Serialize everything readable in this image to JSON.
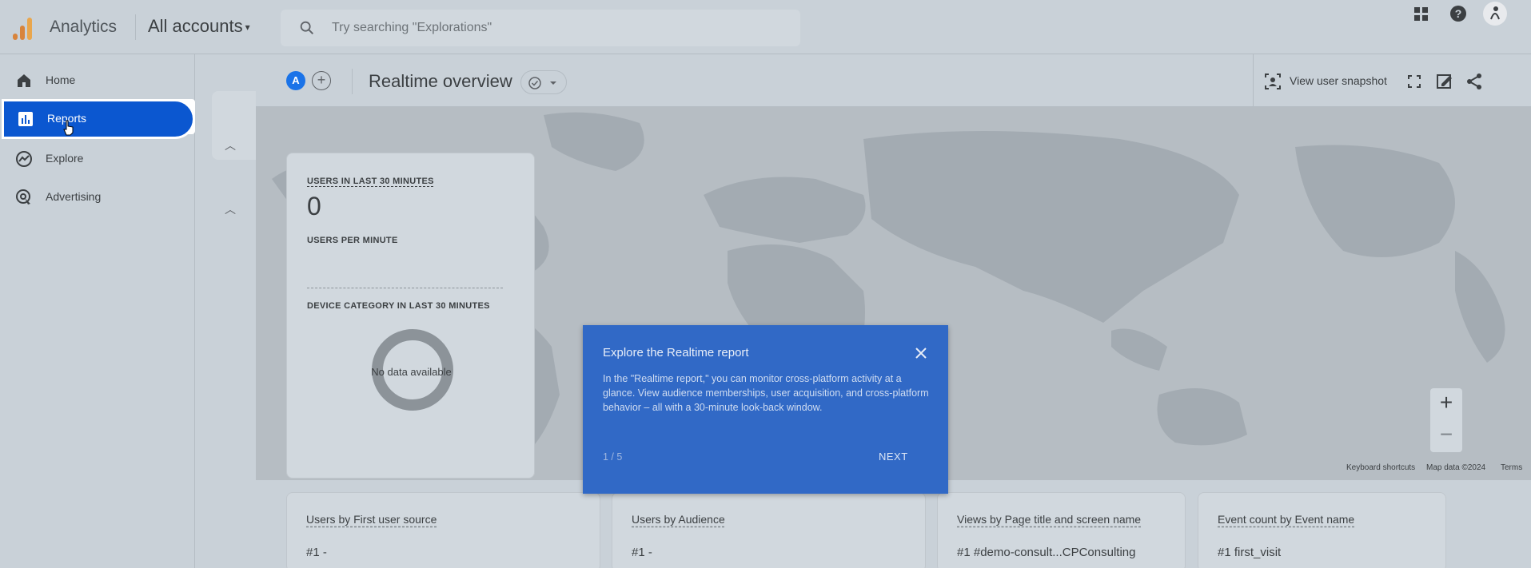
{
  "topbar": {
    "app_name": "Analytics",
    "account_selector": "All accounts",
    "search_placeholder": "Try searching \"Explorations\""
  },
  "sidebar": {
    "items": [
      {
        "label": "Home",
        "icon": "home-icon"
      },
      {
        "label": "Reports",
        "icon": "bar-chart-icon",
        "active": true
      },
      {
        "label": "Explore",
        "icon": "explore-icon"
      },
      {
        "label": "Advertising",
        "icon": "advertising-icon"
      }
    ]
  },
  "header": {
    "avatar_letter": "A",
    "title": "Realtime overview",
    "snapshot_label": "View user snapshot"
  },
  "users_card": {
    "users_30min_label": "USERS IN LAST 30 MINUTES",
    "users_30min_value": "0",
    "users_per_minute_label": "USERS PER MINUTE",
    "device_label": "DEVICE CATEGORY IN LAST 30 MINUTES",
    "no_data": "No data available"
  },
  "map": {
    "keyboard_shortcuts": "Keyboard shortcuts",
    "map_data": "Map data ©2024",
    "terms": "Terms",
    "zoom_in": "+",
    "zoom_out": "−"
  },
  "bottom_cards": [
    {
      "title": "Users by First user source",
      "row": "#1  -"
    },
    {
      "title": "Users by Audience",
      "row": "#1  -"
    },
    {
      "title": "Views by Page title and screen name",
      "row": "#1  #demo-consult...CPConsulting"
    },
    {
      "title": "Event count by Event name",
      "row": "#1  first_visit"
    }
  ],
  "tooltip": {
    "title": "Explore the Realtime report",
    "body": "In the \"Realtime report,\" you can monitor cross-platform activity at a glance. View audience memberships, user acquisition, and cross-platform behavior – all with a 30-minute look-back window.",
    "page": "1 / 5",
    "next": "NEXT"
  },
  "colors": {
    "accent": "#0b57d0",
    "tooltip_bg": "#3169c6",
    "annotation_arrow": "#e8523f"
  }
}
